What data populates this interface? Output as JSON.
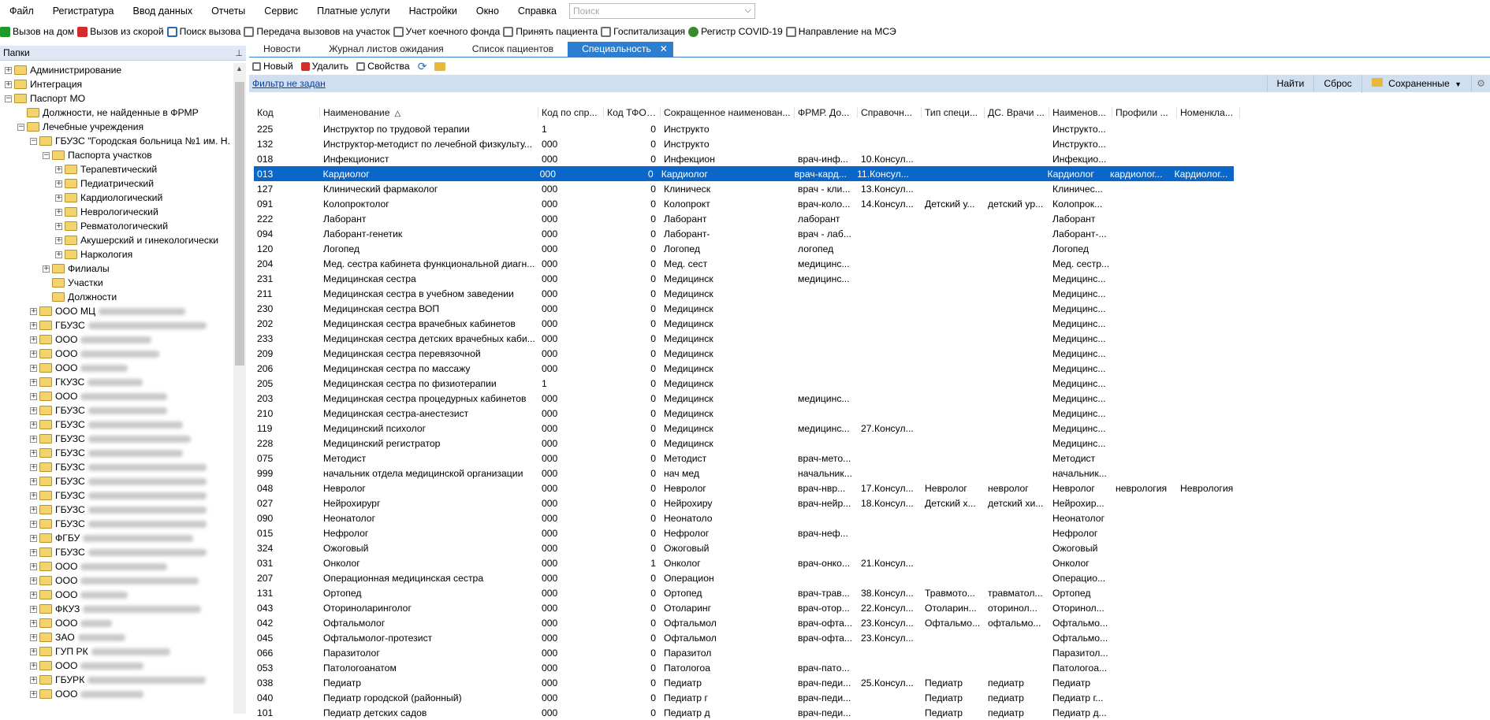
{
  "menu": {
    "items": [
      "Файл",
      "Регистратура",
      "Ввод данных",
      "Отчеты",
      "Сервис",
      "Платные услуги",
      "Настройки",
      "Окно",
      "Справка"
    ],
    "search_placeholder": "Поиск"
  },
  "toolbar": {
    "items": [
      {
        "label": "Вызов на дом",
        "icon": "house-call-icon",
        "color": "#1e9a2a"
      },
      {
        "label": "Вызов из скорой",
        "icon": "ambulance-icon",
        "color": "#d42b2b"
      },
      {
        "label": "Поиск вызова",
        "icon": "search-call-icon",
        "color": "#2a6ab8"
      },
      {
        "label": "Передача вызовов на участок",
        "icon": "transfer-icon",
        "color": "#707070"
      },
      {
        "label": "Учет коечного фонда",
        "icon": "bed-icon",
        "color": "#707070"
      },
      {
        "label": "Принять пациента",
        "icon": "accept-patient-icon",
        "color": "#707070"
      },
      {
        "label": "Госпитализация",
        "icon": "hospitalization-icon",
        "color": "#707070"
      },
      {
        "label": "Регистр COVID-19",
        "icon": "virus-icon",
        "color": "#3a8a2e"
      },
      {
        "label": "Направление на МСЭ",
        "icon": "referral-icon",
        "color": "#707070"
      }
    ]
  },
  "left_panel": {
    "title": "Папки",
    "tree": [
      {
        "label": "Администрирование",
        "level": 0,
        "exp": "+"
      },
      {
        "label": "Интеграция",
        "level": 0,
        "exp": "+"
      },
      {
        "label": "Паспорт МО",
        "level": 0,
        "exp": "-"
      },
      {
        "label": "Должности, не найденные в ФРМР",
        "level": 1,
        "exp": ""
      },
      {
        "label": "Лечебные учреждения",
        "level": 1,
        "exp": "-"
      },
      {
        "label": "ГБУЗС \"Городская больница №1 им. Н.",
        "level": 2,
        "exp": "-"
      },
      {
        "label": "Паспорта участков",
        "level": 3,
        "exp": "-"
      },
      {
        "label": "Терапевтический",
        "level": 4,
        "exp": "+"
      },
      {
        "label": "Педиатрический",
        "level": 4,
        "exp": "+"
      },
      {
        "label": "Кардиологический",
        "level": 4,
        "exp": "+"
      },
      {
        "label": "Неврологический",
        "level": 4,
        "exp": "+"
      },
      {
        "label": "Ревматологический",
        "level": 4,
        "exp": "+"
      },
      {
        "label": "Акушерский и гинекологически",
        "level": 4,
        "exp": "+"
      },
      {
        "label": "Наркология",
        "level": 4,
        "exp": "+"
      },
      {
        "label": "Филиалы",
        "level": 3,
        "exp": "+"
      },
      {
        "label": "Участки",
        "level": 3,
        "exp": ""
      },
      {
        "label": "Должности",
        "level": 3,
        "exp": ""
      },
      {
        "label": "ООО МЦ",
        "level": 2,
        "exp": "+",
        "blur": 110
      },
      {
        "label": "ГБУЗС",
        "level": 2,
        "exp": "+",
        "blur": 150
      },
      {
        "label": "ООО",
        "level": 2,
        "exp": "+",
        "blur": 90
      },
      {
        "label": "ООО",
        "level": 2,
        "exp": "+",
        "blur": 100
      },
      {
        "label": "ООО",
        "level": 2,
        "exp": "+",
        "blur": 60
      },
      {
        "label": "ГКУЗС",
        "level": 2,
        "exp": "+",
        "blur": 70
      },
      {
        "label": "ООО",
        "level": 2,
        "exp": "+",
        "blur": 110
      },
      {
        "label": "ГБУЗС",
        "level": 2,
        "exp": "+",
        "blur": 100
      },
      {
        "label": "ГБУЗС",
        "level": 2,
        "exp": "+",
        "blur": 120
      },
      {
        "label": "ГБУЗС",
        "level": 2,
        "exp": "+",
        "blur": 130
      },
      {
        "label": "ГБУЗС",
        "level": 2,
        "exp": "+",
        "blur": 120
      },
      {
        "label": "ГБУЗС",
        "level": 2,
        "exp": "+",
        "blur": 150
      },
      {
        "label": "ГБУЗС",
        "level": 2,
        "exp": "+",
        "blur": 150
      },
      {
        "label": "ГБУЗС",
        "level": 2,
        "exp": "+",
        "blur": 150
      },
      {
        "label": "ГБУЗС",
        "level": 2,
        "exp": "+",
        "blur": 150
      },
      {
        "label": "ГБУЗС",
        "level": 2,
        "exp": "+",
        "blur": 150
      },
      {
        "label": "ФГБУ",
        "level": 2,
        "exp": "+",
        "blur": 140
      },
      {
        "label": "ГБУЗС",
        "level": 2,
        "exp": "+",
        "blur": 150
      },
      {
        "label": "ООО",
        "level": 2,
        "exp": "+",
        "blur": 110
      },
      {
        "label": "ООО",
        "level": 2,
        "exp": "+",
        "blur": 150
      },
      {
        "label": "ООО",
        "level": 2,
        "exp": "+",
        "blur": 60
      },
      {
        "label": "ФКУЗ",
        "level": 2,
        "exp": "+",
        "blur": 150
      },
      {
        "label": "ООО",
        "level": 2,
        "exp": "+",
        "blur": 40
      },
      {
        "label": "ЗАО",
        "level": 2,
        "exp": "+",
        "blur": 60
      },
      {
        "label": "ГУП РК",
        "level": 2,
        "exp": "+",
        "blur": 100
      },
      {
        "label": "ООО",
        "level": 2,
        "exp": "+",
        "blur": 80
      },
      {
        "label": "ГБУРК",
        "level": 2,
        "exp": "+",
        "blur": 150
      },
      {
        "label": "ООО",
        "level": 2,
        "exp": "+",
        "blur": 80
      }
    ]
  },
  "tabs": [
    {
      "label": "Новости",
      "active": false
    },
    {
      "label": "Журнал листов ожидания",
      "active": false
    },
    {
      "label": "Список пациентов",
      "active": false
    },
    {
      "label": "Специальность",
      "active": true,
      "close": "✕"
    }
  ],
  "right_toolbar": {
    "new_label": "Новый",
    "delete_label": "Удалить",
    "props_label": "Свойства",
    "refresh_icon": "refresh-icon",
    "folder_icon": "folder-icon"
  },
  "filter": {
    "link_label": "Фильтр не задан",
    "find_label": "Найти",
    "reset_label": "Сброс",
    "saved_label": "Сохраненные"
  },
  "grid": {
    "columns": [
      "Код",
      "Наименование",
      "Код по спр...",
      "Код ТФОМС",
      "Сокращенное наименован...",
      "ФРМР. До...",
      "Справочн...",
      "Тип специ...",
      "ДС. Врачи ...",
      "Наименов...",
      "Профили ...",
      "Номенкла..."
    ],
    "selected_index": 3,
    "rows": [
      [
        "225",
        "Инструктор по трудовой терапии",
        "1",
        "0",
        "Инструкто",
        "",
        "",
        "",
        "",
        "Инструкто...",
        "",
        ""
      ],
      [
        "132",
        "Инструктор-методист по лечебной физкульту...",
        "000",
        "0",
        "Инструкто",
        "",
        "",
        "",
        "",
        "Инструкто...",
        "",
        ""
      ],
      [
        "018",
        "Инфекционист",
        "000",
        "0",
        "Инфекцион",
        "врач-инф...",
        "10.Консул...",
        "",
        "",
        "Инфекцио...",
        "",
        ""
      ],
      [
        "013",
        "Кардиолог",
        "000",
        "0",
        "Кардиолог",
        "врач-кард...",
        "11.Консул...",
        "",
        "",
        "Кардиолог",
        "кардиолог...",
        "Кардиолог..."
      ],
      [
        "127",
        "Клинический фармаколог",
        "000",
        "0",
        "Клиническ",
        "врач - кли...",
        "13.Консул...",
        "",
        "",
        "Клиничес...",
        "",
        ""
      ],
      [
        "091",
        "Колопроктолог",
        "000",
        "0",
        "Колопрокт",
        "врач-коло...",
        "14.Консул...",
        "Детский у...",
        "детский ур...",
        "Колопрок...",
        "",
        ""
      ],
      [
        "222",
        "Лаборант",
        "000",
        "0",
        "Лаборант",
        "лаборант",
        "",
        "",
        "",
        "Лаборант",
        "",
        ""
      ],
      [
        "094",
        "Лаборант-генетик",
        "000",
        "0",
        "Лаборант-",
        "врач - лаб...",
        "",
        "",
        "",
        "Лаборант-...",
        "",
        ""
      ],
      [
        "120",
        "Логопед",
        "000",
        "0",
        "Логопед",
        "логопед",
        "",
        "",
        "",
        "Логопед",
        "",
        ""
      ],
      [
        "204",
        "Мед. сестра кабинета функциональной диагн...",
        "000",
        "0",
        "Мед. сест",
        "медицинс...",
        "",
        "",
        "",
        "Мед. сестр...",
        "",
        ""
      ],
      [
        "231",
        "Медицинская сестра",
        "000",
        "0",
        "Медицинск",
        "медицинс...",
        "",
        "",
        "",
        "Медицинс...",
        "",
        ""
      ],
      [
        "211",
        "Медицинская сестра в учебном заведении",
        "000",
        "0",
        "Медицинск",
        "",
        "",
        "",
        "",
        "Медицинс...",
        "",
        ""
      ],
      [
        "230",
        "Медицинская сестра ВОП",
        "000",
        "0",
        "Медицинск",
        "",
        "",
        "",
        "",
        "Медицинс...",
        "",
        ""
      ],
      [
        "202",
        "Медицинская сестра врачебных кабинетов",
        "000",
        "0",
        "Медицинск",
        "",
        "",
        "",
        "",
        "Медицинс...",
        "",
        ""
      ],
      [
        "233",
        "Медицинская сестра детских врачебных каби...",
        "000",
        "0",
        "Медицинск",
        "",
        "",
        "",
        "",
        "Медицинс...",
        "",
        ""
      ],
      [
        "209",
        "Медицинская сестра перевязочной",
        "000",
        "0",
        "Медицинск",
        "",
        "",
        "",
        "",
        "Медицинс...",
        "",
        ""
      ],
      [
        "206",
        "Медицинская сестра по массажу",
        "000",
        "0",
        "Медицинск",
        "",
        "",
        "",
        "",
        "Медицинс...",
        "",
        ""
      ],
      [
        "205",
        "Медицинская сестра по физиотерапии",
        "1",
        "0",
        "Медицинск",
        "",
        "",
        "",
        "",
        "Медицинс...",
        "",
        ""
      ],
      [
        "203",
        "Медицинская сестра процедурных кабинетов",
        "000",
        "0",
        "Медицинск",
        "медицинс...",
        "",
        "",
        "",
        "Медицинс...",
        "",
        ""
      ],
      [
        "210",
        "Медицинская сестра-анестезист",
        "000",
        "0",
        "Медицинск",
        "",
        "",
        "",
        "",
        "Медицинс...",
        "",
        ""
      ],
      [
        "119",
        "Медицинский психолог",
        "000",
        "0",
        "Медицинск",
        "медицинс...",
        "27.Консул...",
        "",
        "",
        "Медицинс...",
        "",
        ""
      ],
      [
        "228",
        "Медицинский регистратор",
        "000",
        "0",
        "Медицинск",
        "",
        "",
        "",
        "",
        "Медицинс...",
        "",
        ""
      ],
      [
        "075",
        "Методист",
        "000",
        "0",
        "Методист",
        "врач-мето...",
        "",
        "",
        "",
        "Методист",
        "",
        ""
      ],
      [
        "999",
        "начальник отдела медицинской организации",
        "000",
        "0",
        "нач мед",
        "начальник...",
        "",
        "",
        "",
        "начальник...",
        "",
        ""
      ],
      [
        "048",
        "Невролог",
        "000",
        "0",
        "Невролог",
        "врач-нвр...",
        "17.Консул...",
        "Невролог",
        "невролог",
        "Невролог",
        "неврология",
        "Неврология"
      ],
      [
        "027",
        "Нейрохирург",
        "000",
        "0",
        "Нейрохиру",
        "врач-нейр...",
        "18.Консул...",
        "Детский х...",
        "детский хи...",
        "Нейрохир...",
        "",
        ""
      ],
      [
        "090",
        "Неонатолог",
        "000",
        "0",
        "Неонатоло",
        "",
        "",
        "",
        "",
        "Неонатолог",
        "",
        ""
      ],
      [
        "015",
        "Нефролог",
        "000",
        "0",
        "Нефролог",
        "врач-неф...",
        "",
        "",
        "",
        "Нефролог",
        "",
        ""
      ],
      [
        "324",
        "Ожоговый",
        "000",
        "0",
        "Ожоговый",
        "",
        "",
        "",
        "",
        "Ожоговый",
        "",
        ""
      ],
      [
        "031",
        "Онколог",
        "000",
        "1",
        "Онколог",
        "врач-онко...",
        "21.Консул...",
        "",
        "",
        "Онколог",
        "",
        ""
      ],
      [
        "207",
        "Операционная медицинская сестра",
        "000",
        "0",
        "Операцион",
        "",
        "",
        "",
        "",
        "Операцио...",
        "",
        ""
      ],
      [
        "131",
        "Ортопед",
        "000",
        "0",
        "Ортопед",
        "врач-трав...",
        "38.Консул...",
        "Травмото...",
        "травматол...",
        "Ортопед",
        "",
        ""
      ],
      [
        "043",
        "Оториноларинголог",
        "000",
        "0",
        "Отоларинг",
        "врач-отор...",
        "22.Консул...",
        "Отоларин...",
        "оторинол...",
        "Оторинол...",
        "",
        ""
      ],
      [
        "042",
        "Офтальмолог",
        "000",
        "0",
        "Офтальмол",
        "врач-офта...",
        "23.Консул...",
        "Офтальмо...",
        "офтальмо...",
        "Офтальмо...",
        "",
        ""
      ],
      [
        "045",
        "Офтальмолог-протезист",
        "000",
        "0",
        "Офтальмол",
        "врач-офта...",
        "23.Консул...",
        "",
        "",
        "Офтальмо...",
        "",
        ""
      ],
      [
        "066",
        "Паразитолог",
        "000",
        "0",
        "Паразитол",
        "",
        "",
        "",
        "",
        "Паразитол...",
        "",
        ""
      ],
      [
        "053",
        "Патологоанатом",
        "000",
        "0",
        "Патологоа",
        "врач-пато...",
        "",
        "",
        "",
        "Патологоа...",
        "",
        ""
      ],
      [
        "038",
        "Педиатр",
        "000",
        "0",
        "Педиатр",
        "врач-педи...",
        "25.Консул...",
        "Педиатр",
        "педиатр",
        "Педиатр",
        "",
        ""
      ],
      [
        "040",
        "Педиатр городской (районный)",
        "000",
        "0",
        "Педиатр г",
        "врач-педи...",
        "",
        "Педиатр",
        "педиатр",
        "Педиатр г...",
        "",
        ""
      ],
      [
        "101",
        "Педиатр детских садов",
        "000",
        "0",
        "Педиатр д",
        "врач-педи...",
        "",
        "Педиатр",
        "педиатр",
        "Педиатр д...",
        "",
        ""
      ]
    ]
  }
}
